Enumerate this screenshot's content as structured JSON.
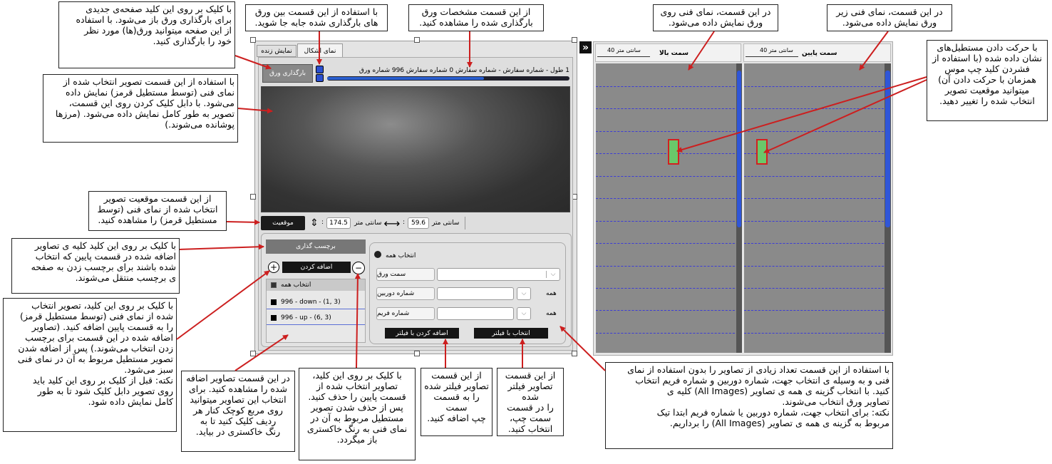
{
  "app": {
    "tabs": [
      "نمایش زنده",
      "نمای اشکال"
    ],
    "load_button": "بارگذاری ورق",
    "sheet_info": "1 طول - شماره سفارش - شماره سفارش 0 شماره سفارش 996 شماره ورق",
    "position_button": "موقعیت",
    "width_value": "174.5",
    "height_value": "59.6",
    "unit": "سانتی متر",
    "label_panel_title": "برچسب گذاری",
    "add_button": "اضافه کردن",
    "plus_symbol": "+",
    "minus_symbol": "−",
    "list": {
      "select_all": "انتخاب همه",
      "items": [
        "996 - down - (1, 3)",
        "996 - up - (6, 3)"
      ]
    },
    "filter": {
      "select_all": "انتخاب همه",
      "side_label": "سمت ورق",
      "camera_label": "شماره دوربین",
      "frame_label": "شماره فریم",
      "all_label": "همه",
      "add_filter_button": "اضافه کردن با فیلتر",
      "select_filter_button": "انتخاب با فیلتر"
    },
    "collapse_icon": "»",
    "top_view": {
      "title": "سمت بالا",
      "ruler": "40 سانتی متر"
    },
    "bottom_view": {
      "title": "سمت پایین",
      "ruler": "40 سانتی متر"
    }
  },
  "annotations": {
    "n1": "با کلیک بر روی این کلید صفحه‌ی جدیدی\nبرای بارگذاری ورق باز می‌شود. با استفاده\nاز این صفحه میتوانید ورق(ها) مورد نظر\nخود را بارگذاری کنید.",
    "n2": "با استفاده از این قسمت بین ورق\nهای بارگذاری شده جابه جا شوید.",
    "n3": "از این قسمت مشخصات ورق\nبارگذاری شده را مشاهده کنید.",
    "n4": "در این قسمت، نمای فنی روی\nورق نمایش داده می‌شود.",
    "n5": "در این قسمت، نمای فنی زیر\nورق نمایش داده می‌شود.",
    "n6": "با حرکت دادن مستطیل‌های\nنشان داده شده (با استفاده از\nفشردن کلید چپ موس\nهمزمان با حرکت دادن آن)\nمیتوانید موقعیت تصویر\nانتخاب شده را تغییر دهید.",
    "n7": "با استفاده از این قسمت تصویر انتخاب شده از\nنمای فنی (توسط مستطیل قرمز) نمایش داده\nمی‌شود. با دابل کلیک کردن روی این قسمت،\nتصویر به طور کامل نمایش داده می‌شود. (مرزها\nپوشانده می‌شوند.)",
    "n8": "از این قسمت موقعیت تصویر\nانتخاب شده از نمای فنی (توسط\nمستطیل قرمز) را مشاهده کنید.",
    "n9": "با کلیک بر روی این کلید کلیه ی تصاویر\nاضافه شده در قسمت پایین که انتخاب\nشده باشند برای برچسب زدن به صفحه\nی برچسب منتقل می‌شوند.",
    "n10": "با کلیک بر روی این کلید، تصویر انتخاب\nشده از نمای فنی (توسط مستطیل قرمز)\nرا به قسمت پایین اضافه کنید. (تصاویر\nاضافه شده در این قسمت برای برچسب\nزدن انتخاب می‌شوند.) پس از اضافه شدن\nتصویر مستطیل مربوط به آن در نمای فنی\nسبز می‌شود.\nنکته: قبل از کلیک بر روی این کلید باید\nروی تصویر دابل کلیک شود تا به طور\nکامل نمایش داده شود.",
    "n11": "در این قسمت تصاویر اضافه\nشده را مشاهده کنید. برای\nانتخاب این تصاویر میتوانید\nروی مربع کوچک کنار هر\nردیف کلیک کنید تا به\nرنگ خاکستری در بیاید.",
    "n12": "با کلیک بر روی این کلید،\nتصاویر انتخاب شده از\nقسمت پایین را حذف کنید.\nپس از حذف شدن تصویر\nمستطیل مربوط به آن در\nنمای فنی به رنگ خاکستری\nباز میگردد.",
    "n13": "از این قسمت\nتصاویر فیلتر شده\nرا به قسمت سمت\nچپ اضافه کنید.",
    "n14": "از این قسمت\nتصاویر فیلتر شده\nرا در قسمت\nسمت چپ،\nانتخاب کنید.",
    "n15": "با استفاده از این قسمت تعداد زیادی از تصاویر را بدون استفاده از نمای\nفنی و به وسیله ی انتخاب جهت، شماره دوربین و شماره فریم انتخاب\nکنید. با انتخاب گزینه ی همه ی تصاویر (All Images) کلیه ی\nتصاویر ورق انتخاب می‌شوند.\nنکته: برای انتخاب جهت، شماره دوربین یا شماره فریم ابتدا تیک\nمربوط به گزینه ی همه ی تصاویر (All Images) را برداریم."
  }
}
